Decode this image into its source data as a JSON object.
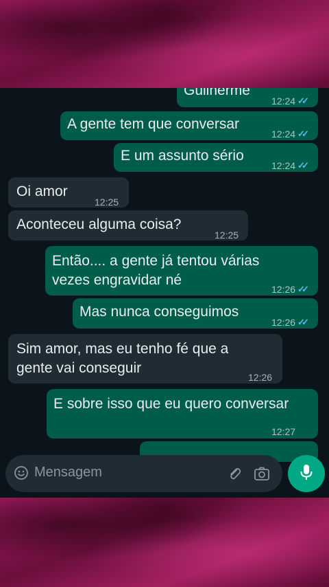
{
  "messages": [
    {
      "text": "Guilherme",
      "time": "12:24",
      "dir": "out"
    },
    {
      "text": "A gente tem que conversar",
      "time": "12:24",
      "dir": "out"
    },
    {
      "text": "E um assunto sério",
      "time": "12:24",
      "dir": "out"
    },
    {
      "text": "Oi amor",
      "time": "12:25",
      "dir": "in"
    },
    {
      "text": "Aconteceu alguma coisa?",
      "time": "12:25",
      "dir": "in"
    },
    {
      "text": "Então.... a gente já tentou várias\nvezes engravidar né",
      "time": "12:26",
      "dir": "out"
    },
    {
      "text": "Mas nunca conseguimos",
      "time": "12:26",
      "dir": "out"
    },
    {
      "text": "Sim amor, mas eu tenho fé que a\ngente vai conseguir",
      "time": "12:26",
      "dir": "in"
    },
    {
      "text": "E sobre isso que eu quero conversar",
      "time": "12:27",
      "dir": "out"
    }
  ],
  "input": {
    "placeholder": "Mensagem"
  },
  "icons": {
    "emoji": "emoji-icon",
    "attach": "paperclip-icon",
    "camera": "camera-icon",
    "mic": "microphone-icon",
    "scroll": "chevron-double-down-icon",
    "read_receipt": "double-check-icon"
  },
  "colors": {
    "outgoing_bubble": "#005c4b",
    "incoming_bubble": "#1f2c34",
    "chat_background": "#0b141a",
    "read_tick": "#53bdeb",
    "accent": "#00a884"
  }
}
